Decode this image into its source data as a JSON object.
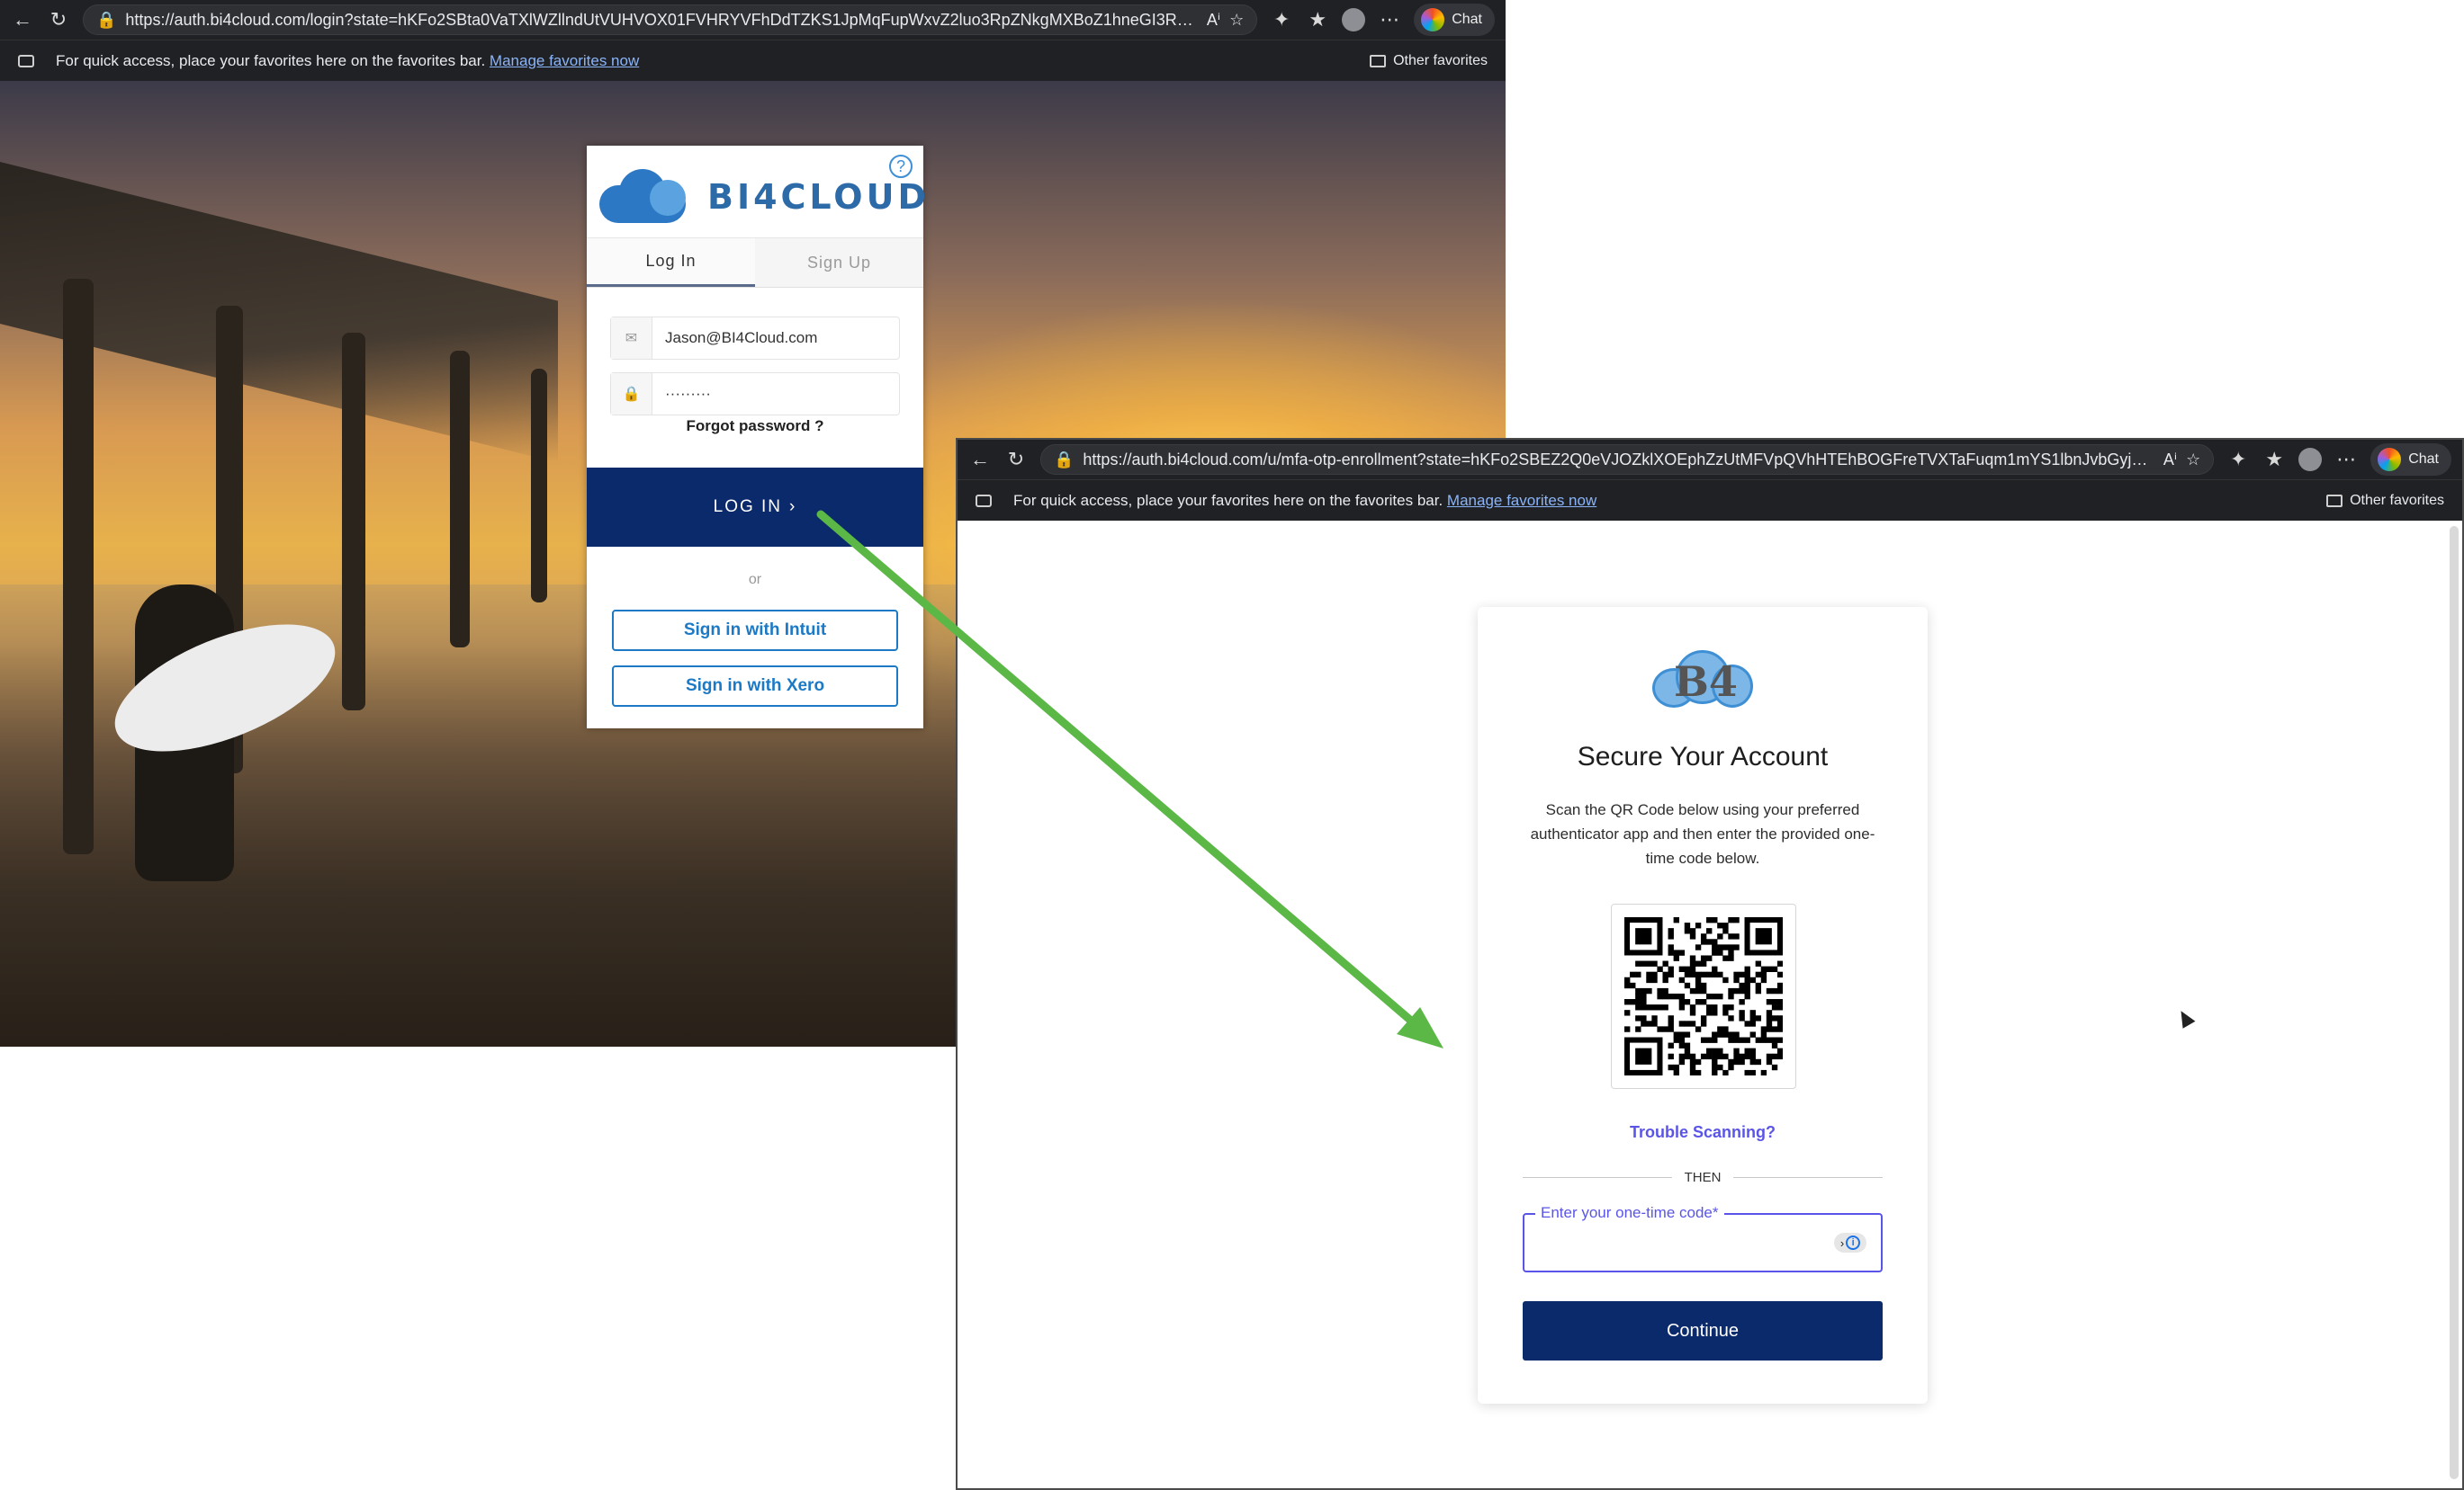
{
  "colors": {
    "brand_navy": "#0b2a6b",
    "accent_purple": "#5a55e8",
    "sso_blue": "#1b79c5",
    "arrow_green": "#5bb846",
    "chrome_dark": "#202124"
  },
  "browser1": {
    "url": "https://auth.bi4cloud.com/login?state=hKFo2SBta0VaTXlWZllndUtVUHVOX01FVHRYVFhDdTZKS1JpMqFupWxvZ2luo3RpZNkgMXBoZ1hneGI3RXJJQTR2...",
    "chat_label": "Chat",
    "favorites_text": "For quick access, place your favorites here on the favorites bar.",
    "manage_link": "Manage favorites now",
    "other_favorites": "Other favorites",
    "icons": [
      "back-arrow-icon",
      "refresh-icon",
      "lock-icon",
      "read-aloud-icon",
      "favorite-star-icon",
      "extensions-icon",
      "favorites-icon",
      "profile-icon",
      "more-icon",
      "copilot-icon"
    ]
  },
  "login": {
    "brand": "BI4CLOUD",
    "help": "?",
    "tabs": [
      {
        "label": "Log In",
        "active": true
      },
      {
        "label": "Sign Up",
        "active": false
      }
    ],
    "email_value": "Jason@BI4Cloud.com",
    "password_value": "·········",
    "forgot": "Forgot password ?",
    "login_button": "LOG IN",
    "or": "or",
    "sso": [
      "Sign in with Intuit",
      "Sign in with Xero"
    ]
  },
  "browser2": {
    "url": "https://auth.bi4cloud.com/u/mfa-otp-enrollment?state=hKFo2SBEZ2Q0eVJOZklXOEphZzUtMFVpQVhHTEhBOGFreTVXTaFuqm1mYS1lbnJvbGyjdGlk2SA...",
    "chat_label": "Chat",
    "favorites_text": "For quick access, place your favorites here on the favorites bar.",
    "manage_link": "Manage favorites now",
    "other_favorites": "Other favorites"
  },
  "mfa": {
    "logo_glyph": "B4",
    "title": "Secure Your Account",
    "instructions": "Scan the QR Code below using your preferred authenticator app and then enter the provided one-time code below.",
    "trouble_link": "Trouble Scanning?",
    "divider": "THEN",
    "otp_label": "Enter your one-time code*",
    "otp_value": "",
    "continue_button": "Continue"
  }
}
